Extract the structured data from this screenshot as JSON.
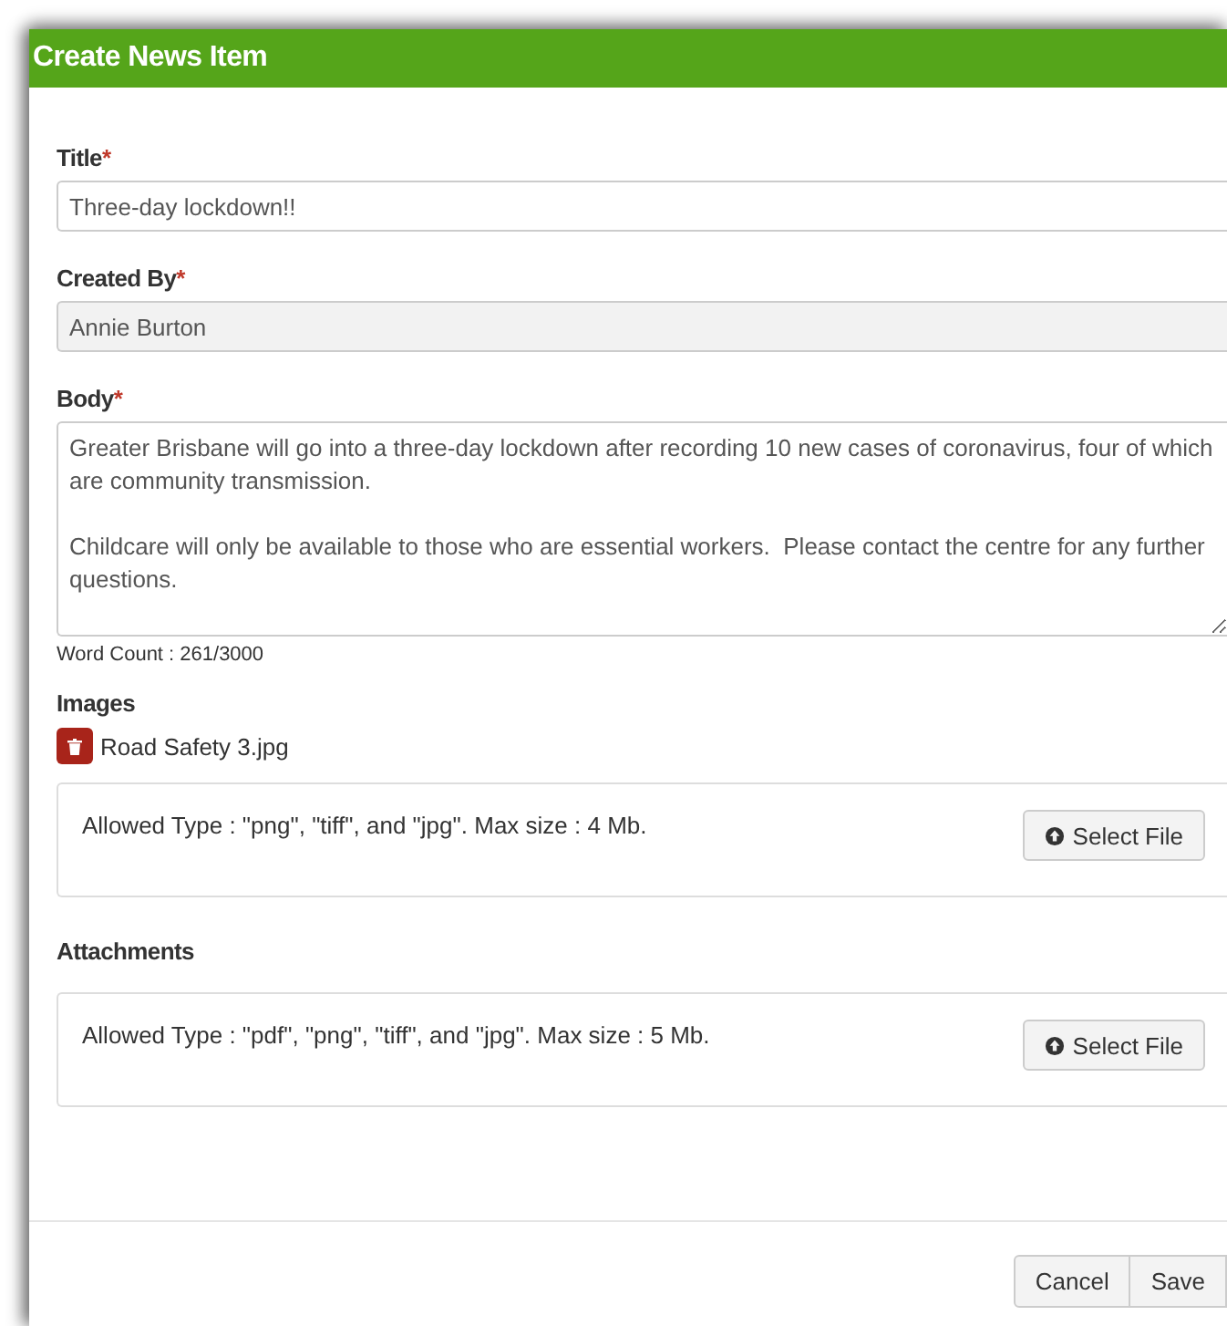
{
  "dialog": {
    "title": "Create News Item"
  },
  "fields": [
    {
      "kind": "input",
      "label": "Title",
      "required_mark": "*",
      "value": "Three-day lockdown!!",
      "disabled": false
    },
    {
      "kind": "input",
      "label": "Created By",
      "required_mark": "*",
      "value": "Annie Burton",
      "disabled": true
    },
    {
      "kind": "textarea",
      "label": "Body",
      "required_mark": "*",
      "value": "Greater Brisbane will go into a three-day lockdown after recording 10 new cases of coronavirus, four of which are community transmission.\n\nChildcare will only be available to those who are essential workers.  Please contact the centre for any further questions.",
      "disabled": false,
      "word_count": "Word Count : 261/3000"
    }
  ],
  "uploads": [
    {
      "label": "Images",
      "files": [
        "Road Safety 3.jpg"
      ],
      "note": "Allowed Type : \"png\", \"tiff\", and \"jpg\". Max size : 4 Mb.",
      "button": "Select File"
    },
    {
      "label": "Attachments",
      "note": "Allowed Type : \"pdf\", \"png\", \"tiff\", and \"jpg\". Max size : 5 Mb.",
      "button": "Select File"
    }
  ],
  "footer_buttons": [
    "Cancel",
    "Save"
  ]
}
